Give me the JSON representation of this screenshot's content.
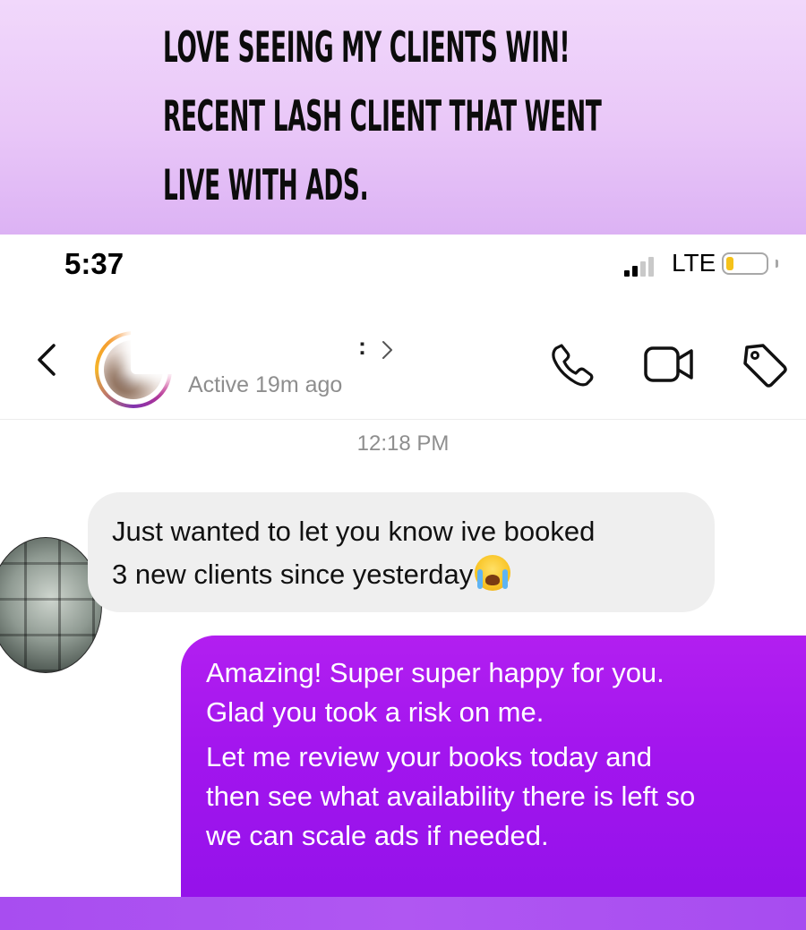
{
  "banner": {
    "lines": [
      "LOVE SEEING MY CLIENTS WIN!",
      "RECENT LASH CLIENT THAT WENT",
      "LIVE WITH ADS."
    ]
  },
  "status_bar": {
    "time": "5:37",
    "network": "LTE",
    "signal_bars_filled": 2,
    "signal_bars_total": 4,
    "battery_level": 0.2,
    "battery_color": "#f5c21a"
  },
  "chat_header": {
    "name_suffix": ":",
    "status": "Active 19m ago",
    "icons": [
      "back-icon",
      "avatar",
      "chevron-right-icon",
      "call-icon",
      "video-icon",
      "tag-icon"
    ]
  },
  "conversation": {
    "timestamp": "12:18 PM",
    "received": {
      "lines": [
        "Just wanted to let you know ive booked",
        "3 new clients since yesterday"
      ],
      "emoji": "loudly-crying-face-icon"
    },
    "sent": {
      "lines": [
        "Amazing! Super super happy for you.",
        "Glad you took a risk on me.",
        "Let me review your books today and",
        "then see what availability there is left so",
        "we can scale ads if needed."
      ]
    }
  },
  "colors": {
    "banner_top": "#f1d8fb",
    "banner_bottom": "#dcb2f4",
    "sent_bubble": "#a215ee",
    "received_bubble": "#efefef",
    "footer": "#b057f2"
  }
}
